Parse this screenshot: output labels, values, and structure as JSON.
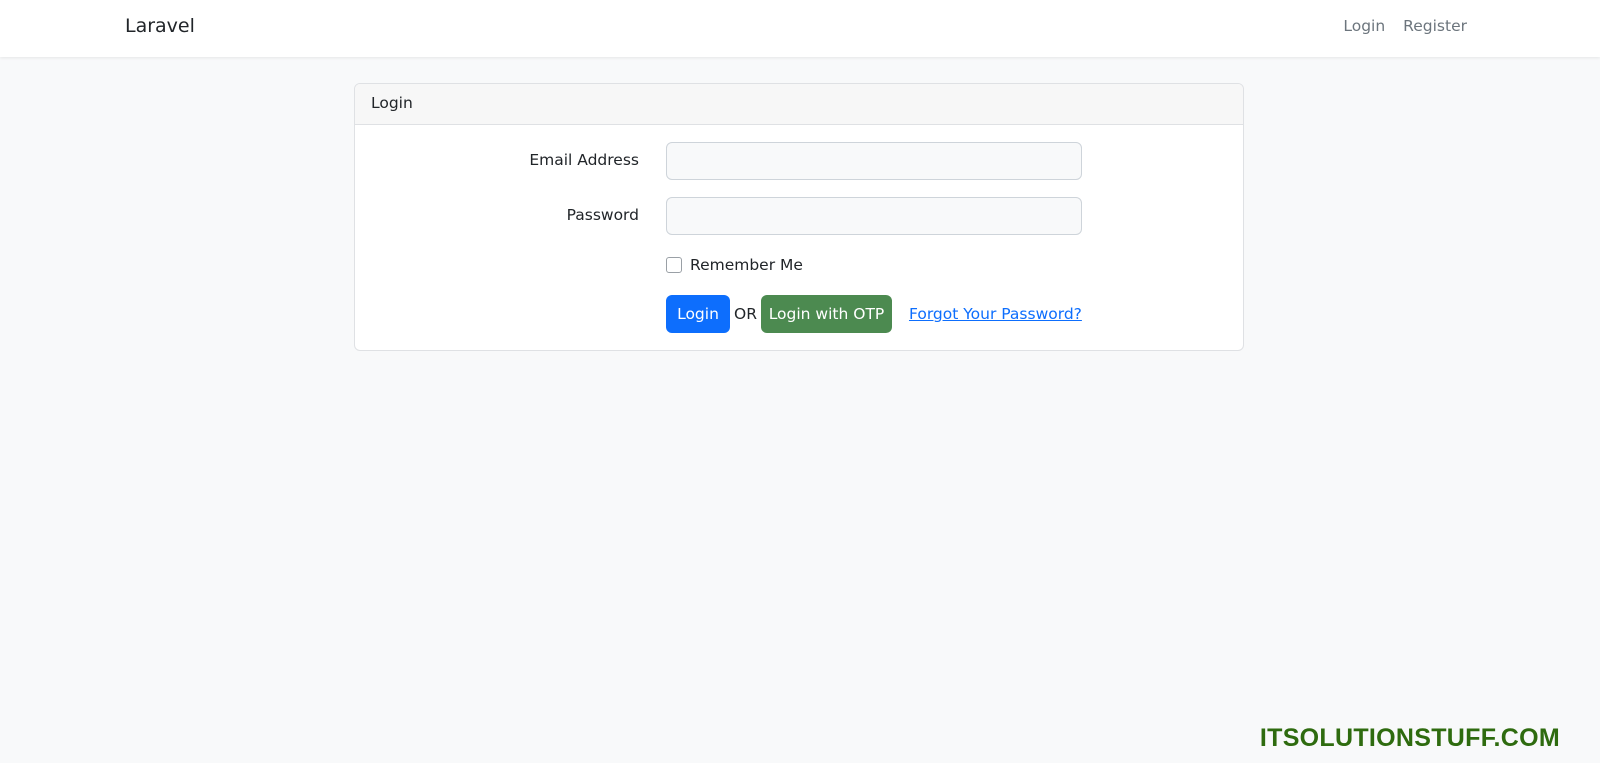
{
  "navbar": {
    "brand": "Laravel",
    "links": [
      "Login",
      "Register"
    ]
  },
  "card": {
    "header": "Login",
    "email": {
      "label": "Email Address",
      "value": "",
      "placeholder": ""
    },
    "password": {
      "label": "Password",
      "value": "",
      "placeholder": ""
    },
    "remember": {
      "label": "Remember Me",
      "checked": false
    },
    "login_button": "Login",
    "or_text": "OR",
    "otp_button": "Login with OTP",
    "forgot_link": "Forgot Your Password?"
  },
  "watermark": "ITSOLUTIONSTUFF.COM",
  "colors": {
    "primary": "#0d6efd",
    "success": "#4c8a50",
    "watermark": "#2e6b0f",
    "background": "#f8f9fa"
  }
}
